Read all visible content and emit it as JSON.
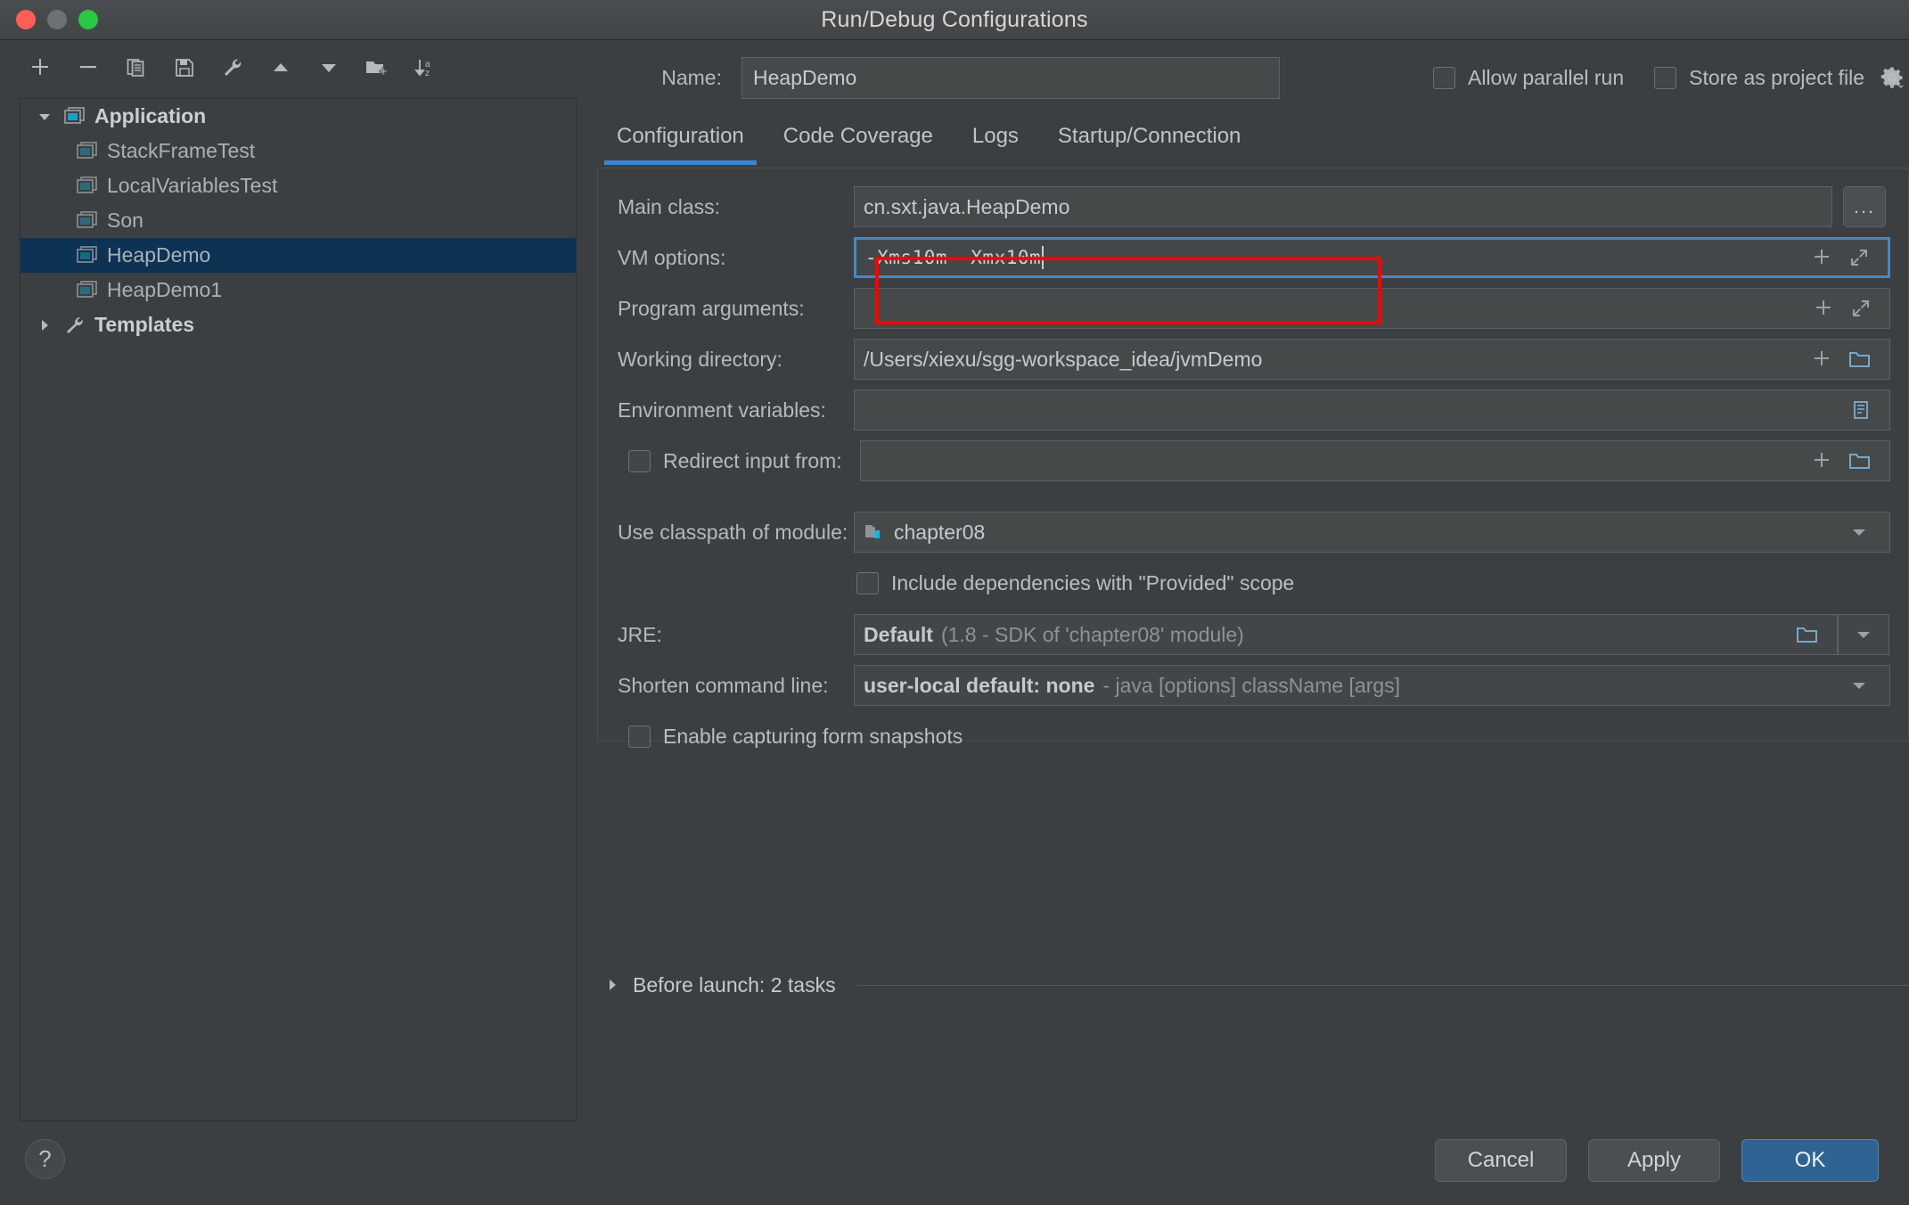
{
  "window": {
    "title": "Run/Debug Configurations"
  },
  "toolbar": {
    "icons": [
      {
        "name": "add-icon",
        "label": "Add New Configuration"
      },
      {
        "name": "remove-icon",
        "label": "Remove Configuration"
      },
      {
        "name": "copy-icon",
        "label": "Copy Configuration"
      },
      {
        "name": "save-icon",
        "label": "Save Configuration"
      },
      {
        "name": "edit-templates-icon",
        "label": "Edit Templates"
      },
      {
        "name": "move-up-icon",
        "label": "Move Up"
      },
      {
        "name": "move-down-icon",
        "label": "Move Down"
      },
      {
        "name": "new-folder-icon",
        "label": "Create New Folder"
      },
      {
        "name": "sort-alphabetically-icon",
        "label": "Sort Configurations"
      }
    ]
  },
  "tree": {
    "items": [
      {
        "label": "Application",
        "level": 0,
        "expanded": true,
        "bold": true,
        "icon": "application-icon",
        "selected": false
      },
      {
        "label": "StackFrameTest",
        "level": 1,
        "expanded": null,
        "bold": false,
        "icon": "run-config-icon",
        "selected": false
      },
      {
        "label": "LocalVariablesTest",
        "level": 1,
        "expanded": null,
        "bold": false,
        "icon": "run-config-icon",
        "selected": false
      },
      {
        "label": "Son",
        "level": 1,
        "expanded": null,
        "bold": false,
        "icon": "run-config-icon",
        "selected": false
      },
      {
        "label": "HeapDemo",
        "level": 1,
        "expanded": null,
        "bold": false,
        "icon": "run-config-icon",
        "selected": true
      },
      {
        "label": "HeapDemo1",
        "level": 1,
        "expanded": null,
        "bold": false,
        "icon": "run-config-icon",
        "selected": false
      },
      {
        "label": "Templates",
        "level": 0,
        "expanded": false,
        "bold": true,
        "icon": "wrench-icon",
        "selected": false
      }
    ]
  },
  "header": {
    "name_label": "Name:",
    "name_value": "HeapDemo",
    "allow_parallel_run_label": "Allow parallel run",
    "allow_parallel_run_checked": false,
    "store_as_project_file_label": "Store as project file",
    "store_as_project_file_checked": false,
    "gear_icon": "gear-dropdown-icon"
  },
  "tabs": [
    {
      "label": "Configuration",
      "active": true
    },
    {
      "label": "Code Coverage",
      "active": false
    },
    {
      "label": "Logs",
      "active": false
    },
    {
      "label": "Startup/Connection",
      "active": false
    }
  ],
  "form": {
    "main_class": {
      "label": "Main class:",
      "value": "cn.sxt.java.HeapDemo",
      "browse_label": "..."
    },
    "vm_options": {
      "label": "VM options:",
      "value": "-Xms10m  -Xmx10m",
      "focused": true,
      "highlighted": true,
      "highlight_color": "#fe0000"
    },
    "program_arguments": {
      "label": "Program arguments:",
      "value": ""
    },
    "working_directory": {
      "label": "Working directory:",
      "value": "/Users/xiexu/sgg-workspace_idea/jvmDemo"
    },
    "environment_variables": {
      "label": "Environment variables:",
      "value": ""
    },
    "redirect_input": {
      "label": "Redirect input from:",
      "checked": false,
      "value": ""
    },
    "classpath_module": {
      "label": "Use classpath of module:",
      "value": "chapter08"
    },
    "include_provided": {
      "label": "Include dependencies with \"Provided\" scope",
      "checked": false
    },
    "jre": {
      "label": "JRE:",
      "value": "Default",
      "value_hint": "(1.8 - SDK of 'chapter08' module)"
    },
    "shorten_command_line": {
      "label": "Shorten command line:",
      "value": "user-local default: none",
      "value_hint": "- java [options] className [args]"
    },
    "form_snapshots": {
      "label": "Enable capturing form snapshots",
      "checked": false
    }
  },
  "before_launch": {
    "label": "Before launch: 2 tasks",
    "expanded": false
  },
  "footer": {
    "help_label": "?",
    "cancel_label": "Cancel",
    "apply_label": "Apply",
    "ok_label": "OK"
  },
  "colors": {
    "accent_blue": "#3d85d0",
    "ok_button": "#2f6394",
    "selection": "#0d3253",
    "annotation_red": "#fe0000"
  }
}
